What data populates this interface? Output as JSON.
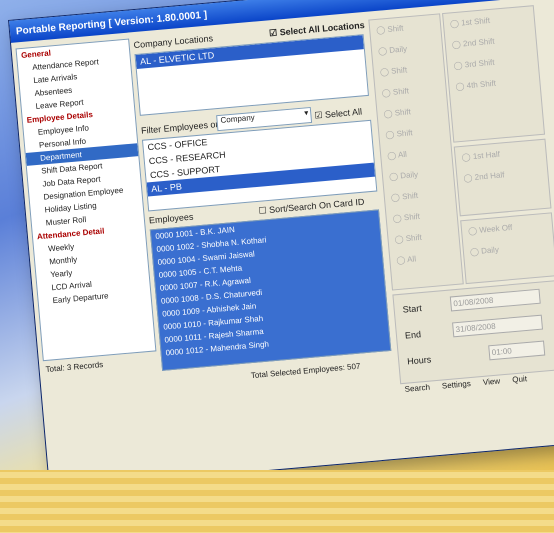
{
  "window": {
    "title": "Portable Reporting  [ Version: 1.80.0001 ]",
    "close": "×"
  },
  "tree": [
    {
      "label": "General",
      "group": true
    },
    {
      "label": "Attendance Report",
      "group": false
    },
    {
      "label": "Late Arrivals",
      "group": false
    },
    {
      "label": "Absentees",
      "group": false
    },
    {
      "label": "Leave Report",
      "group": false
    },
    {
      "label": "Employee Details",
      "group": true
    },
    {
      "label": "Employee Info",
      "group": false
    },
    {
      "label": "Personal Info",
      "group": false
    },
    {
      "label": "Department",
      "group": false,
      "selected": true
    },
    {
      "label": "Shift Data Report",
      "group": false
    },
    {
      "label": "Job Data Report",
      "group": false
    },
    {
      "label": "Designation Employee",
      "group": false
    },
    {
      "label": "Holiday Listing",
      "group": false
    },
    {
      "label": "Muster Roll",
      "group": false
    },
    {
      "label": "Attendance Detail",
      "group": true
    },
    {
      "label": "Weekly",
      "group": false
    },
    {
      "label": "Monthly",
      "group": false
    },
    {
      "label": "Yearly",
      "group": false
    },
    {
      "label": "LCD Arrival",
      "group": false
    },
    {
      "label": "Early Departure",
      "group": false
    }
  ],
  "tree_footer": "Total: 3 Records",
  "company": {
    "label": "Company Locations",
    "select_all": "Select All Locations",
    "selected_item": "AL  - ELVETIC LTD"
  },
  "filter": {
    "label": "Filter Employees on",
    "value": "Company",
    "select_all": "Select All"
  },
  "filter_items": [
    {
      "label": "CCS - OFFICE",
      "selected": false
    },
    {
      "label": "CCS - RESEARCH",
      "selected": false
    },
    {
      "label": "CCS - SUPPORT",
      "selected": false
    },
    {
      "label": "AL  - PB",
      "selected": true
    }
  ],
  "employees": {
    "label": "Employees",
    "search_checkbox": "Sort/Search On Card ID",
    "items": [
      "0000 1001  -  B.K. JAIN",
      "0000 1002  -  Shobha N. Kothari",
      "0000 1004  -  Swami Jaiswal",
      "0000 1005  -  C.T. Mehta",
      "0000 1007  -  R.K. Agrawal",
      "0000 1008  -  D.S. Chaturvedi",
      "0000 1009  -  Abhishek Jain",
      "0000 1010  -  Rajkumar Shah",
      "0000 1011  -  Rajesh Sharma",
      "0000 1012  -  Mahendra Singh"
    ]
  },
  "total_selected": "Total Selected Employees: 507",
  "toolbar": [
    {
      "label": "Search",
      "icon": "search-icon",
      "glyph": "🔍"
    },
    {
      "label": "Settings",
      "icon": "settings-icon",
      "glyph": "⚙"
    },
    {
      "label": "View",
      "icon": "view-icon",
      "glyph": "👁"
    },
    {
      "label": "Quit",
      "icon": "quit-icon",
      "glyph": "⏻"
    }
  ],
  "shift_left": [
    "Shift",
    "Daily",
    "Shift",
    "Shift",
    "Shift",
    "Shift",
    "All",
    "Daily",
    "Shift",
    "Shift",
    "Shift",
    "All"
  ],
  "shift_right_top": [
    "1st Shift",
    "2nd Shift",
    "3rd Shift",
    "4th Shift"
  ],
  "shift_right_mid": [
    "1st Half",
    "2nd Half"
  ],
  "shift_right_bottom": [
    "Week Off",
    "Daily"
  ],
  "dates": {
    "start_label": "Start",
    "start_value": "01/08/2008",
    "end_label": "End",
    "end_value": "31/08/2008",
    "hours_label": "Hours",
    "hours_value": "01:00"
  }
}
